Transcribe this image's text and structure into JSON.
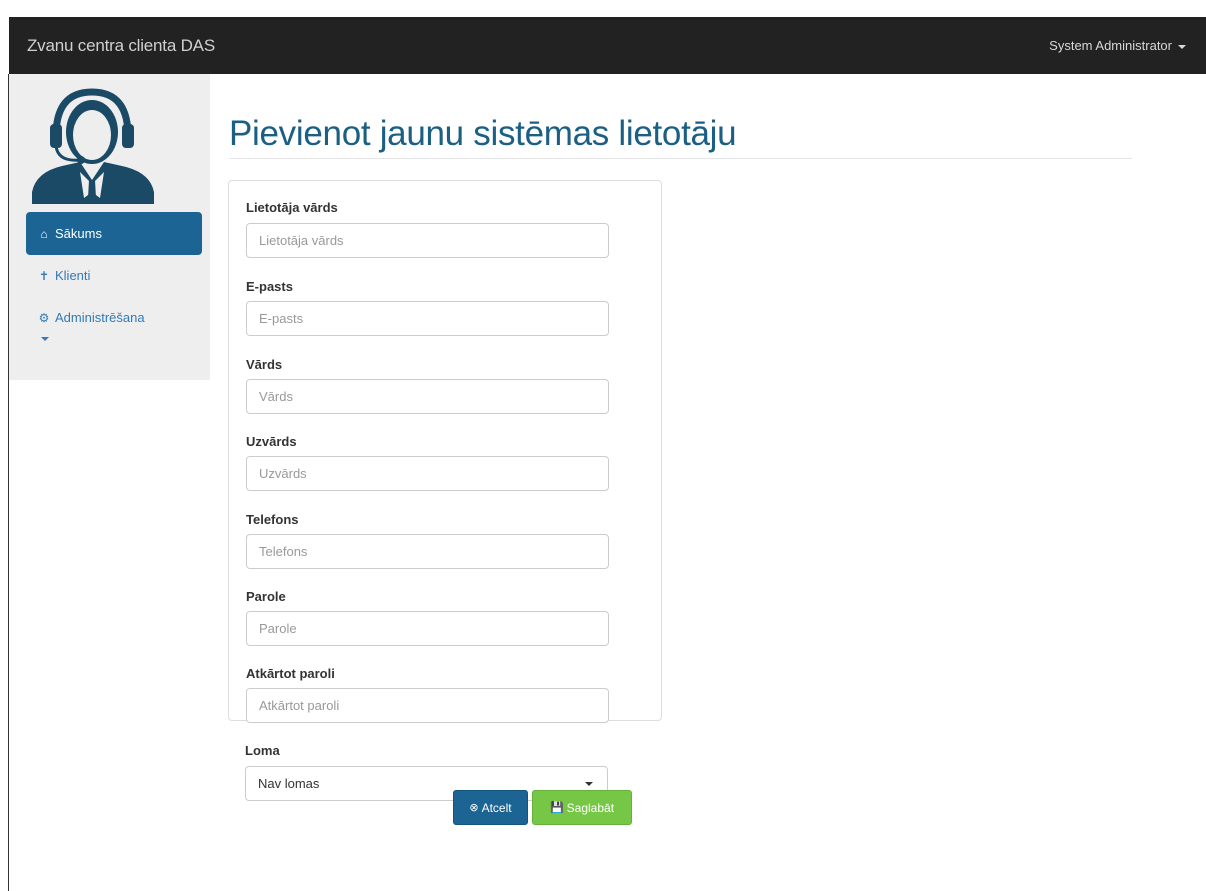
{
  "navbar": {
    "brand": "Zvanu centra clienta DAS",
    "user": "System Administrator"
  },
  "sidebar": {
    "items": [
      {
        "label": "Sākums",
        "icon": "home-icon"
      },
      {
        "label": "Klienti",
        "icon": "person-icon"
      },
      {
        "label": "Administrēšana",
        "icon": "gears-icon"
      }
    ]
  },
  "page": {
    "title": "Pievienot jaunu sistēmas lietotāju"
  },
  "form": {
    "fields": [
      {
        "label": "Lietotāja vārds",
        "placeholder": "Lietotāja vārds"
      },
      {
        "label": "E-pasts",
        "placeholder": "E-pasts"
      },
      {
        "label": "Vārds",
        "placeholder": "Vārds"
      },
      {
        "label": "Uzvārds",
        "placeholder": "Uzvārds"
      },
      {
        "label": "Telefons",
        "placeholder": "Telefons"
      },
      {
        "label": "Parole",
        "placeholder": "Parole"
      },
      {
        "label": "Atkārtot paroli",
        "placeholder": "Atkārtot paroli"
      }
    ],
    "role": {
      "label": "Loma",
      "value": "Nav lomas"
    },
    "cancel_label": "Atcelt",
    "save_label": "Saglabāt"
  },
  "colors": {
    "navbar": "#222222",
    "accent": "#1b6493",
    "title": "#1b5f85",
    "save": "#76c745"
  }
}
